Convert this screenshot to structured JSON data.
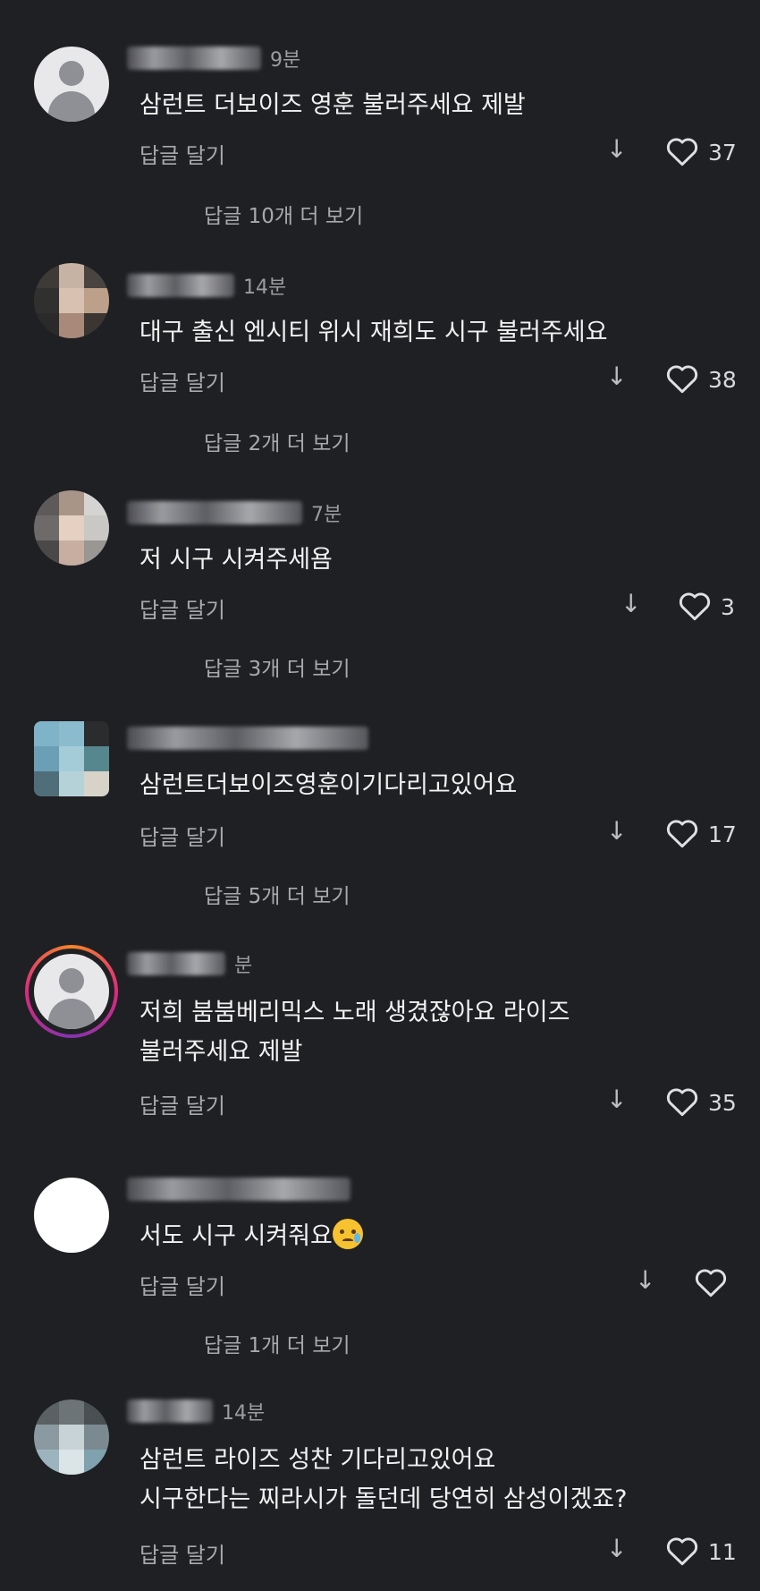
{
  "reply_label": "답글 달기",
  "comments": [
    {
      "time": "9분",
      "text": [
        "삼런트 더보이즈 영훈 불러주세요 제발"
      ],
      "likes": "37",
      "more": "답글 10개 더 보기"
    },
    {
      "time": "14분",
      "text": [
        "대구 출신 엔시티 위시 재희도 시구 불러주세요"
      ],
      "likes": "38",
      "more": "답글 2개 더 보기"
    },
    {
      "time": "7분",
      "text": [
        "저 시구 시켜주세욤"
      ],
      "likes": "3",
      "more": "답글 3개 더 보기"
    },
    {
      "time": "",
      "text": [
        "삼런트더보이즈영훈이기다리고있어요"
      ],
      "likes": "17",
      "more": "답글 5개 더 보기"
    },
    {
      "time": "분",
      "text": [
        "저희 붐붐베리믹스 노래 생겼잖아요 라이즈",
        "불러주세요 제발"
      ],
      "likes": "35",
      "more": ""
    },
    {
      "time": "",
      "text": [
        "서도 시구 시켜줘요"
      ],
      "emoji": "crying-face",
      "likes": "",
      "more": "답글 1개 더 보기"
    },
    {
      "time": "14분",
      "text": [
        "삼런트 라이즈 성찬 기다리고있어요",
        "시구한다는 찌라시가 돌던데 당연히 삼성이겠죠?"
      ],
      "likes": "11",
      "more": ""
    }
  ],
  "icons": {
    "down": "down-arrow-icon",
    "like": "heart-icon",
    "avatar_default": "default-avatar-icon"
  }
}
